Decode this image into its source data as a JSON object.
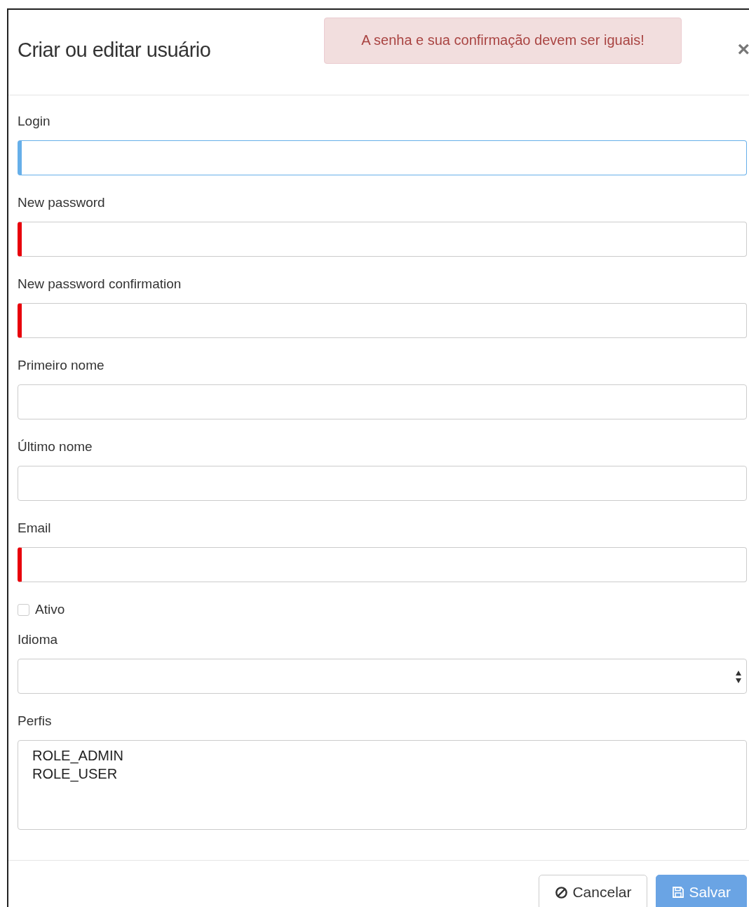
{
  "dialog": {
    "title": "Criar ou editar usuário",
    "close": "×"
  },
  "alert": {
    "message": "A senha e sua confirmação devem ser iguais!"
  },
  "fields": [
    {
      "label": "Login",
      "kind": "text",
      "focused": true,
      "invalid": false
    },
    {
      "label": "New password",
      "kind": "text",
      "focused": false,
      "invalid": true
    },
    {
      "label": "New password confirmation",
      "kind": "text",
      "focused": false,
      "invalid": true
    },
    {
      "label": "Primeiro nome",
      "kind": "text",
      "focused": false,
      "invalid": false
    },
    {
      "label": "Último nome",
      "kind": "text",
      "focused": false,
      "invalid": false
    },
    {
      "label": "Email",
      "kind": "text",
      "focused": false,
      "invalid": true
    },
    {
      "label": "Ativo",
      "kind": "checkbox",
      "checked": false
    },
    {
      "label": "Idioma",
      "kind": "select"
    },
    {
      "label": "Perfis",
      "kind": "listbox",
      "options": [
        {
          "label": "ROLE_ADMIN",
          "selected": false
        },
        {
          "label": "ROLE_USER",
          "selected": false
        }
      ]
    }
  ],
  "buttons": [
    {
      "label": "Cancelar",
      "kind": "cancel",
      "disabled": false
    },
    {
      "label": "Salvar",
      "kind": "save",
      "disabled": true
    }
  ]
}
